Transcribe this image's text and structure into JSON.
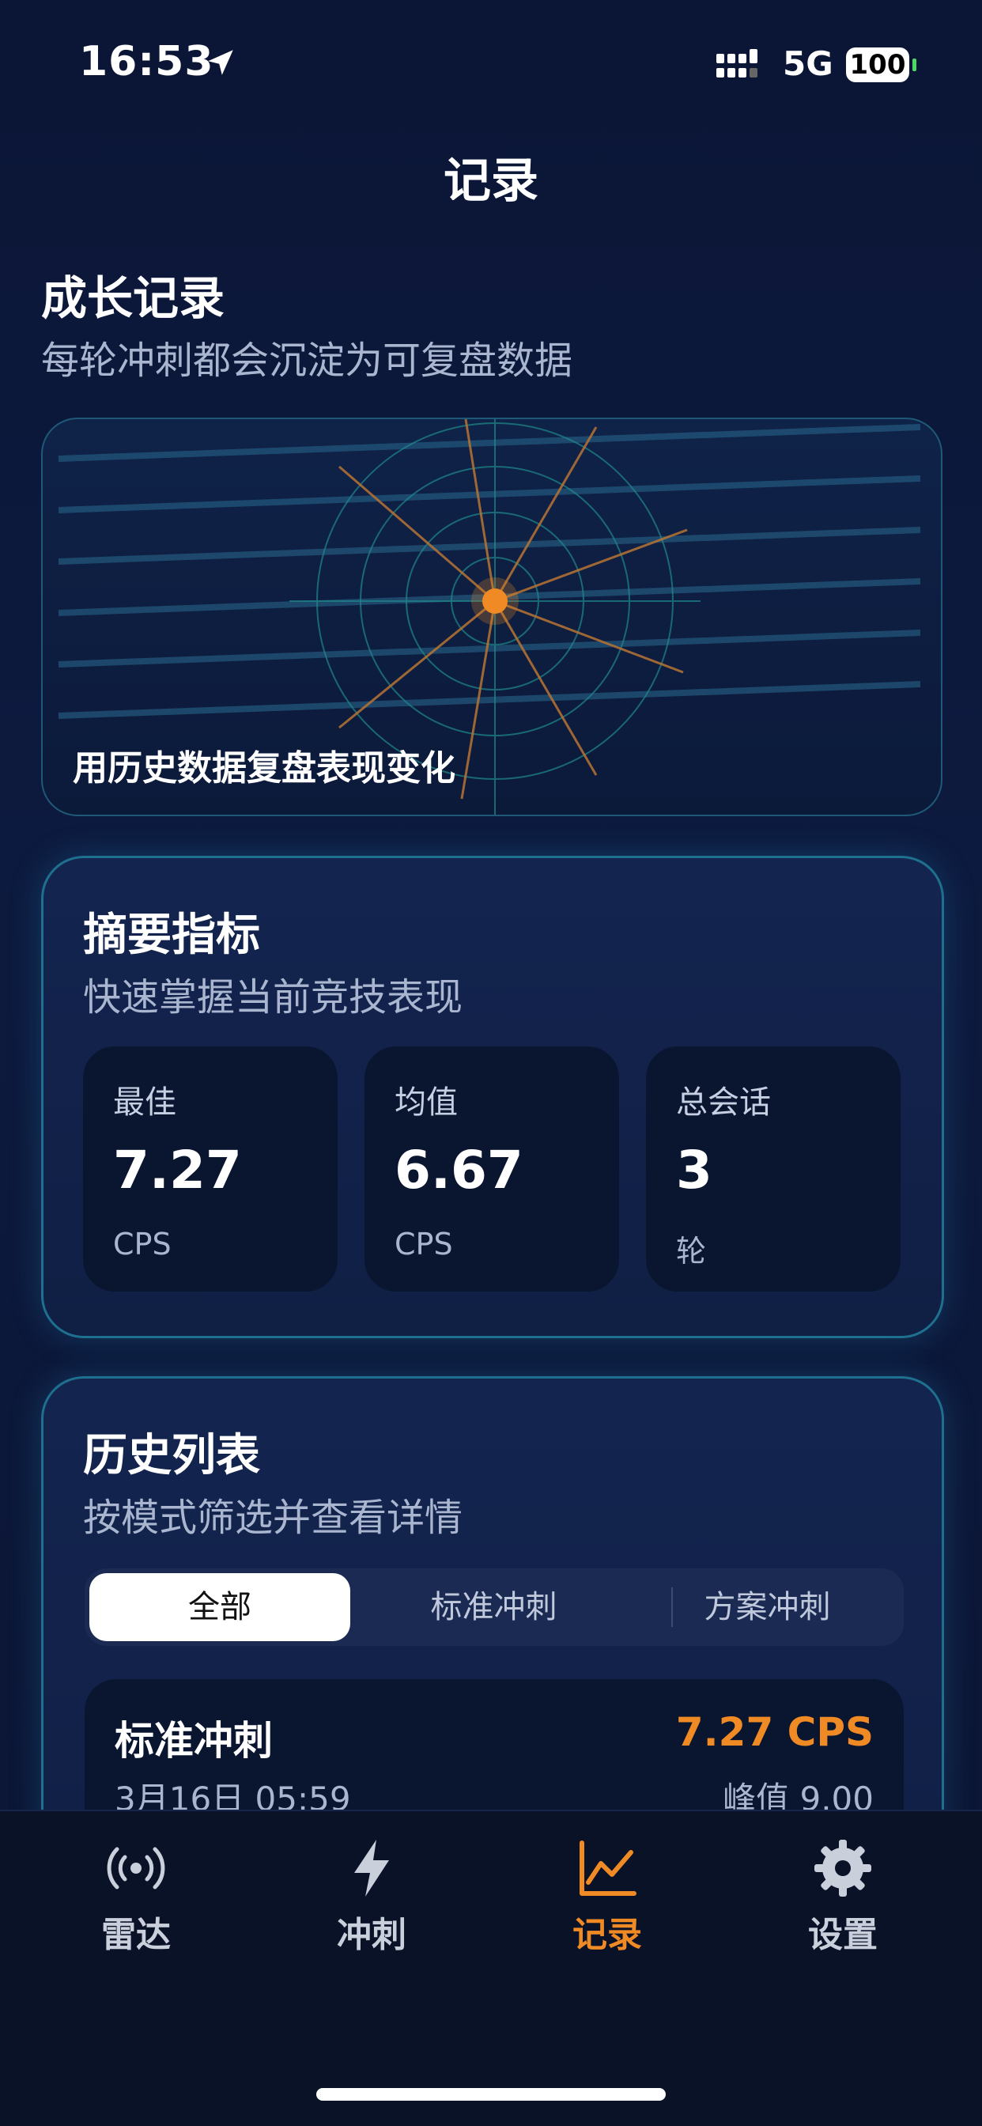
{
  "status_bar": {
    "time": "16:53",
    "network": "5G",
    "battery": "100"
  },
  "nav": {
    "title": "记录"
  },
  "growth": {
    "title": "成长记录",
    "subtitle": "每轮冲刺都会沉淀为可复盘数据",
    "hero_caption": "用历史数据复盘表现变化"
  },
  "summary": {
    "title": "摘要指标",
    "subtitle": "快速掌握当前竞技表现",
    "metrics": [
      {
        "label": "最佳",
        "value": "7.27",
        "unit": "CPS"
      },
      {
        "label": "均值",
        "value": "6.67",
        "unit": "CPS"
      },
      {
        "label": "总会话",
        "value": "3",
        "unit": "轮"
      }
    ]
  },
  "history": {
    "title": "历史列表",
    "subtitle": "按模式筛选并查看详情",
    "filters": [
      "全部",
      "标准冲刺",
      "方案冲刺"
    ],
    "selected_filter": "全部",
    "items": [
      {
        "mode": "标准冲刺",
        "date": "3月16日 05:59",
        "cps": "7.27 CPS",
        "peak": "峰值 9.00"
      }
    ]
  },
  "tab_bar": {
    "tabs": [
      {
        "label": "雷达",
        "icon": "radar-icon"
      },
      {
        "label": "冲刺",
        "icon": "bolt-icon"
      },
      {
        "label": "记录",
        "icon": "chart-icon",
        "active": true
      },
      {
        "label": "设置",
        "icon": "gear-icon"
      }
    ]
  },
  "colors": {
    "accent": "#f08a24",
    "background": "#0b1636",
    "card_border": "#1f6f8e"
  }
}
